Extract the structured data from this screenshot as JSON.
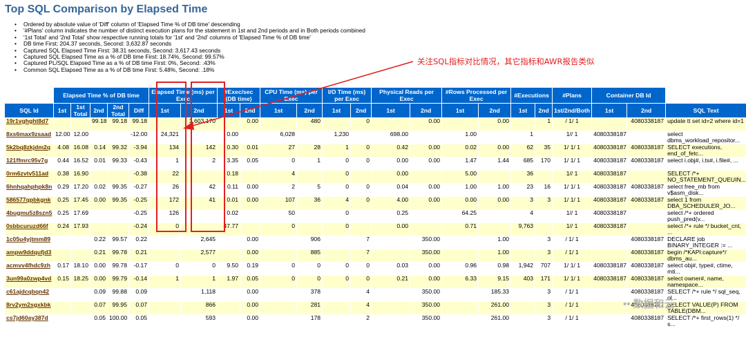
{
  "title": "Top SQL Comparison by Elapsed Time",
  "notes": [
    "Ordered by absolute value of 'Diff' column of 'Elapsed Time % of DB time' descending",
    "'#Plans' column indicates the number of distinct execution plans for the statement in 1st and 2nd periods and in Both periods combined",
    "'1st Total' and '2nd Total' show respective running totals for '1st' and '2nd' columns of 'Elapsed Time % of DB time'",
    "DB time First: 204.37 seconds, Second: 3,632.87 seconds",
    "Captured SQL Elapsed Time First: 38.31 seconds, Second: 3,617.43 seconds",
    "Captured SQL Elapsed Time as a % of DB time First: 18.74%, Second: 99.57%",
    "Captured PL/SQL Elapsed Time as a % of DB time First: 0%, Second: .43%",
    "Common SQL Elapsed Time as a % of DB time First: 5.48%, Second: .18%"
  ],
  "annotation": "关注SQL指标对比情况，其它指标和AWR报告类似",
  "watermark": "数据和云",
  "table": {
    "groups": {
      "elapsed_pct": "Elapsed Time % of DB time",
      "elapsed_ms": "Elapsed Time (ms) per Exec",
      "exec_sec": "#Exec/sec (DB time)",
      "cpu": "CPU Time (ms) per Exec",
      "io": "I/O Time (ms) per Exec",
      "reads": "Physical Reads per Exec",
      "rows": "#Rows Processed per Exec",
      "executions": "#Executions",
      "plans": "#Plans",
      "container": "Container DB Id"
    },
    "headers": {
      "sql_id": "SQL Id",
      "first": "1st",
      "first_total": "1st Total",
      "second": "2nd",
      "second_total": "2nd Total",
      "diff": "Diff",
      "plans_sub": "1st/2nd/Both",
      "sql_text": "SQL Text"
    },
    "rows": [
      [
        "19r1vghght8d7",
        "",
        "",
        "99.18",
        "99.18",
        "99.18",
        "",
        "3,603,170",
        "",
        "0.00",
        "",
        "480",
        "",
        "0",
        "",
        "0.00",
        "",
        "0.00",
        "",
        "1",
        "/ 1/ 1",
        "",
        "4080338187",
        "update tt set id=2 where id=1"
      ],
      [
        "8xs6max9zsaad",
        "12.00",
        "12.00",
        "",
        "",
        "-12.00",
        "24,321",
        "",
        "0.00",
        "",
        "6,028",
        "",
        "1,230",
        "",
        "698.00",
        "",
        "1.00",
        "",
        "1",
        "",
        "1// 1",
        "4080338187",
        "",
        "select dbms_workload_repositor..."
      ],
      [
        "5k2bq8zkjdm2q",
        "4.08",
        "16.08",
        "0.14",
        "99.32",
        "-3.94",
        "134",
        "142",
        "0.30",
        "0.01",
        "27",
        "28",
        "1",
        "0",
        "0.42",
        "0.00",
        "0.02",
        "0.00",
        "62",
        "35",
        "1/ 1/ 1",
        "4080338187",
        "4080338187",
        "SELECT executions, end_of_fetc..."
      ],
      [
        "121ffmrc95v7g",
        "0.44",
        "16.52",
        "0.01",
        "99.33",
        "-0.43",
        "1",
        "2",
        "3.35",
        "0.05",
        "0",
        "1",
        "0",
        "0",
        "0.00",
        "0.00",
        "1.47",
        "1.44",
        "685",
        "170",
        "1/ 1/ 1",
        "4080338187",
        "4080338187",
        "select i.obj#, i.ts#, i.file#, ..."
      ],
      [
        "0rm6zvtv511ad",
        "0.38",
        "16.90",
        "",
        "",
        "-0.38",
        "22",
        "",
        "0.18",
        "",
        "4",
        "",
        "0",
        "",
        "0.00",
        "",
        "5.00",
        "",
        "36",
        "",
        "1// 1",
        "4080338187",
        "",
        "SELECT /*+ NO_STATEMENT_QUEUIN..."
      ],
      [
        "6hnhqahphpk8n",
        "0.29",
        "17.20",
        "0.02",
        "99.35",
        "-0.27",
        "26",
        "42",
        "0.11",
        "0.00",
        "2",
        "5",
        "0",
        "0",
        "0.04",
        "0.00",
        "1.00",
        "1.00",
        "23",
        "16",
        "1/ 1/ 1",
        "4080338187",
        "4080338187",
        "select free_mb from v$asm_disk..."
      ],
      [
        "586577qpbkgnk",
        "0.25",
        "17.45",
        "0.00",
        "99.35",
        "-0.25",
        "172",
        "41",
        "0.01",
        "0.00",
        "107",
        "36",
        "4",
        "0",
        "4.00",
        "0.00",
        "0.00",
        "0.00",
        "3",
        "3",
        "1/ 1/ 1",
        "4080338187",
        "4080338187",
        "select 1 from DBA_SCHEDULER_JO..."
      ],
      [
        "4bugmu5z8szn5",
        "0.25",
        "17.69",
        "",
        "",
        "-0.25",
        "126",
        "",
        "0.02",
        "",
        "50",
        "",
        "0",
        "",
        "0.25",
        "",
        "64.25",
        "",
        "4",
        "",
        "1// 1",
        "4080338187",
        "",
        "select /*+ ordered push_pred(v..."
      ],
      [
        "0sbbcuruzd66f",
        "0.24",
        "17.93",
        "",
        "",
        "-0.24",
        "0",
        "",
        "47.77",
        "",
        "0",
        "",
        "0",
        "",
        "0.00",
        "",
        "0.71",
        "",
        "9,763",
        "",
        "1// 1",
        "4080338187",
        "",
        "select /*+ rule */ bucket_cnt, ..."
      ],
      [
        "1c05u4yjtmm89",
        "",
        "",
        "0.22",
        "99.57",
        "0.22",
        "",
        "2,645",
        "",
        "0.00",
        "",
        "906",
        "",
        "7",
        "",
        "350.00",
        "",
        "1.00",
        "",
        "3",
        "/ 1/ 1",
        "",
        "4080338187",
        "DECLARE job BINARY_INTEGER := ..."
      ],
      [
        "ampw9ddqufjd3",
        "",
        "",
        "0.21",
        "99.78",
        "0.21",
        "",
        "2,577",
        "",
        "0.00",
        "",
        "885",
        "",
        "7",
        "",
        "350.00",
        "",
        "1.00",
        "",
        "3",
        "/ 1/ 1",
        "",
        "4080338187",
        "begin /*KAPI:capture*/ dbms_au..."
      ],
      [
        "acmvv4fhdc9zh",
        "0.17",
        "18.10",
        "0.00",
        "99.78",
        "-0.17",
        "0",
        "0",
        "9.50",
        "0.19",
        "0",
        "0",
        "0",
        "0",
        "0.03",
        "0.00",
        "0.96",
        "0.98",
        "1,942",
        "707",
        "1/ 1/ 1",
        "4080338187",
        "4080338187",
        "select obj#, type#, ctime, mti..."
      ],
      [
        "3un99a0zwp4vd",
        "0.15",
        "18.25",
        "0.00",
        "99.79",
        "-0.14",
        "1",
        "1",
        "1.97",
        "0.05",
        "0",
        "0",
        "0",
        "0",
        "0.21",
        "0.00",
        "6.33",
        "9.15",
        "403",
        "171",
        "1/ 1/ 1",
        "4080338187",
        "4080338187",
        "select owner#, name, namespace..."
      ],
      [
        "c61ajdcqbqn42",
        "",
        "",
        "0.09",
        "99.88",
        "0.09",
        "",
        "1,118",
        "",
        "0.00",
        "",
        "378",
        "",
        "4",
        "",
        "350.00",
        "",
        "185.33",
        "",
        "3",
        "/ 1/ 1",
        "",
        "4080338187",
        "SELECT /*+ rule */ sql_seq, ol..."
      ],
      [
        "8rv2ym2sgxkbk",
        "",
        "",
        "0.07",
        "99.95",
        "0.07",
        "",
        "866",
        "",
        "0.00",
        "",
        "281",
        "",
        "4",
        "",
        "350.00",
        "",
        "261.00",
        "",
        "3",
        "/ 1/ 1",
        "",
        "4080338187",
        "SELECT VALUE(P) FROM TABLE(DBM..."
      ],
      [
        "cs7jd60ay387d",
        "",
        "",
        "0.05",
        "100.00",
        "0.05",
        "",
        "593",
        "",
        "0.00",
        "",
        "178",
        "",
        "2",
        "",
        "350.00",
        "",
        "261.00",
        "",
        "3",
        "/ 1/ 1",
        "",
        "4080338187",
        "SELECT /*+ first_rows(1) */ s..."
      ]
    ]
  }
}
